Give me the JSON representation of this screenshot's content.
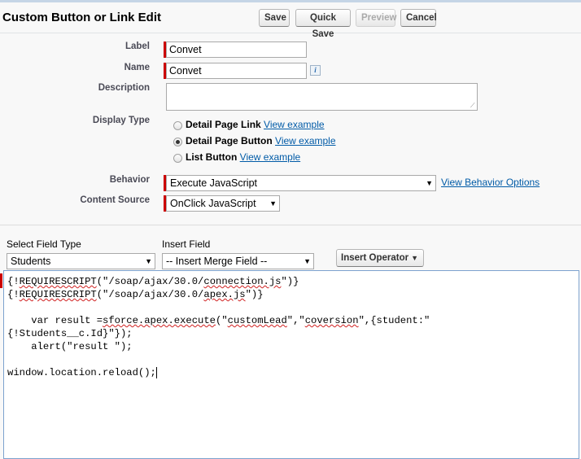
{
  "header": {
    "title": "Custom Button or Link Edit",
    "save_label": "Save",
    "quick_save_label": "Quick Save",
    "preview_label": "Preview",
    "cancel_label": "Cancel"
  },
  "form": {
    "label_label": "Label",
    "label_value": "Convet",
    "name_label": "Name",
    "name_value": "Convet",
    "info_glyph": "i",
    "description_label": "Description",
    "description_value": "",
    "display_type_label": "Display Type",
    "display_types": [
      {
        "label": "Detail Page Link",
        "link": "View example",
        "checked": false
      },
      {
        "label": "Detail Page Button",
        "link": "View example",
        "checked": true
      },
      {
        "label": "List Button",
        "link": "View example",
        "checked": false
      }
    ],
    "behavior_label": "Behavior",
    "behavior_value": "Execute JavaScript",
    "behavior_link": "View Behavior Options",
    "content_source_label": "Content Source",
    "content_source_value": "OnClick JavaScript"
  },
  "editor_toolbar": {
    "select_field_type_label": "Select Field Type",
    "select_field_type_value": "Students",
    "insert_field_label": "Insert Field",
    "insert_field_value": "-- Insert Merge Field --",
    "insert_operator_label": "Insert Operator"
  },
  "editor": {
    "lines": [
      {
        "prefix": "{!",
        "word": "REQUIRESCRIPT",
        "mid": "(\"/soap/ajax/30.0/",
        "word2": "connection.js",
        "suffix": "\")}"
      },
      {
        "prefix": "{!",
        "word": "REQUIRESCRIPT",
        "mid": "(\"/soap/ajax/30.0/",
        "word2": "apex.js",
        "suffix": "\")}"
      },
      {
        "text": ""
      },
      {
        "prefix": "    var result =",
        "word": "sforce.apex.execute",
        "mid": "(\"",
        "word2": "customLead",
        "suffix": "\",\"",
        "word3": "coversion",
        "suffix2": "\",{student:\""
      },
      {
        "text": "{!Students__c.Id}\"});"
      },
      {
        "text": "    alert(\"result \");"
      },
      {
        "text": ""
      },
      {
        "text": "window.location.reload();"
      }
    ]
  },
  "colors": {
    "required": "#cc0000",
    "link": "#015ba7",
    "editor_border": "#7da2ce"
  },
  "icons": {
    "dropdown": "chevron-down-icon",
    "info": "info-icon"
  }
}
